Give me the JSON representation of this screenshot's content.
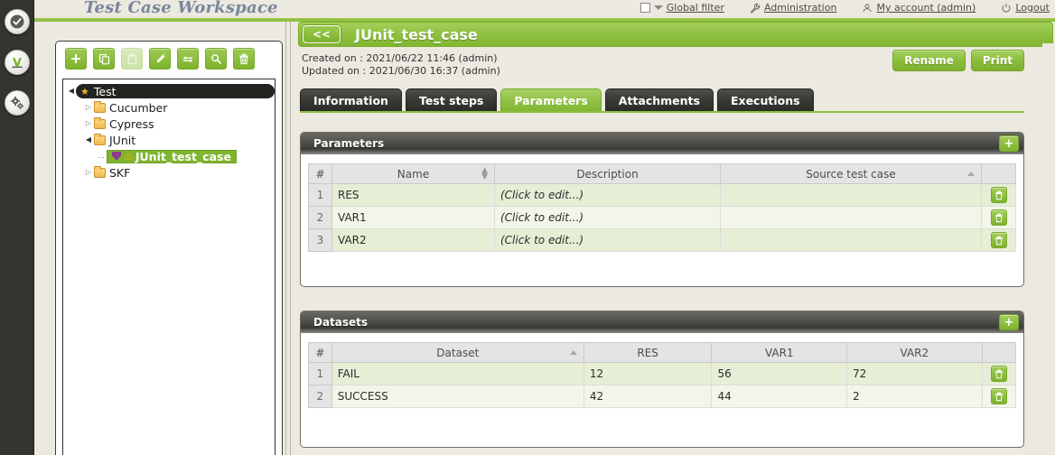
{
  "workspace": {
    "title": "Test Case Workspace"
  },
  "rail": {
    "items": [
      {
        "name": "test-case-workspace-icon",
        "glyph": "✔"
      },
      {
        "name": "campaign-workspace-icon",
        "glyph": "A"
      },
      {
        "name": "automation-workspace-icon",
        "glyph": "⚙"
      }
    ]
  },
  "topnav": {
    "global_filter": "Global filter",
    "administration": "Administration",
    "my_account": "My account (admin)",
    "logout": "Logout"
  },
  "tree_toolbar": {
    "buttons": [
      {
        "name": "add-button",
        "glyph": "✚",
        "disabled": false
      },
      {
        "name": "copy-button",
        "glyph": "❐",
        "disabled": false
      },
      {
        "name": "paste-button",
        "glyph": "❑",
        "disabled": true
      },
      {
        "name": "rename-button",
        "glyph": "✎",
        "disabled": false
      },
      {
        "name": "move-button",
        "glyph": "⇄",
        "disabled": false
      },
      {
        "name": "search-button",
        "glyph": "⌕",
        "disabled": false
      },
      {
        "name": "delete-button",
        "glyph": "🗑",
        "disabled": false
      }
    ]
  },
  "tree": {
    "root": "Test",
    "nodes": [
      {
        "label": "Cucumber",
        "type": "folder",
        "expanded": false,
        "depth": 1
      },
      {
        "label": "Cypress",
        "type": "folder",
        "expanded": false,
        "depth": 1
      },
      {
        "label": "JUnit",
        "type": "folder",
        "expanded": true,
        "depth": 1
      },
      {
        "label": "JUnit_test_case",
        "type": "testcase",
        "selected": true,
        "depth": 2
      },
      {
        "label": "SKF",
        "type": "folder",
        "expanded": false,
        "depth": 1
      }
    ]
  },
  "header": {
    "back_label": "<<",
    "test_case_name": "JUnit_test_case",
    "created_on": "Created on :  2021/06/22 11:46 (admin)",
    "updated_on": "Updated on :  2021/06/30 16:37 (admin)",
    "rename_label": "Rename",
    "print_label": "Print"
  },
  "tabs": [
    {
      "label": "Information",
      "active": false
    },
    {
      "label": "Test steps",
      "active": false
    },
    {
      "label": "Parameters",
      "active": true
    },
    {
      "label": "Attachments",
      "active": false
    },
    {
      "label": "Executions",
      "active": false
    }
  ],
  "parameters_panel": {
    "title": "Parameters",
    "add_label": "+",
    "columns": [
      "#",
      "Name",
      "Description",
      "Source test case",
      ""
    ],
    "sort": {
      "Name": "both",
      "Source test case": "asc"
    },
    "rows": [
      {
        "num": "1",
        "name": "RES",
        "description": "(Click to edit...)",
        "source": ""
      },
      {
        "num": "2",
        "name": "VAR1",
        "description": "(Click to edit...)",
        "source": ""
      },
      {
        "num": "3",
        "name": "VAR2",
        "description": "(Click to edit...)",
        "source": ""
      }
    ],
    "delete_glyph": "🗑"
  },
  "datasets_panel": {
    "title": "Datasets",
    "add_label": "+",
    "columns": [
      "#",
      "Dataset",
      "RES",
      "VAR1",
      "VAR2",
      ""
    ],
    "sort": {
      "Dataset": "asc"
    },
    "rows": [
      {
        "num": "1",
        "dataset": "FAIL",
        "res": "12",
        "var1": "56",
        "var2": "72"
      },
      {
        "num": "2",
        "dataset": "SUCCESS",
        "res": "42",
        "var1": "44",
        "var2": "2"
      }
    ],
    "delete_glyph": "🗑"
  },
  "colors": {
    "accent_green": "#8cbf3e",
    "dark_panel": "#3a3a36",
    "rail_dark": "#343430",
    "page_bg": "#ece9e1",
    "row_odd": "#e6eed6",
    "row_even": "#f2f6e8",
    "title_blue": "#79869b"
  }
}
